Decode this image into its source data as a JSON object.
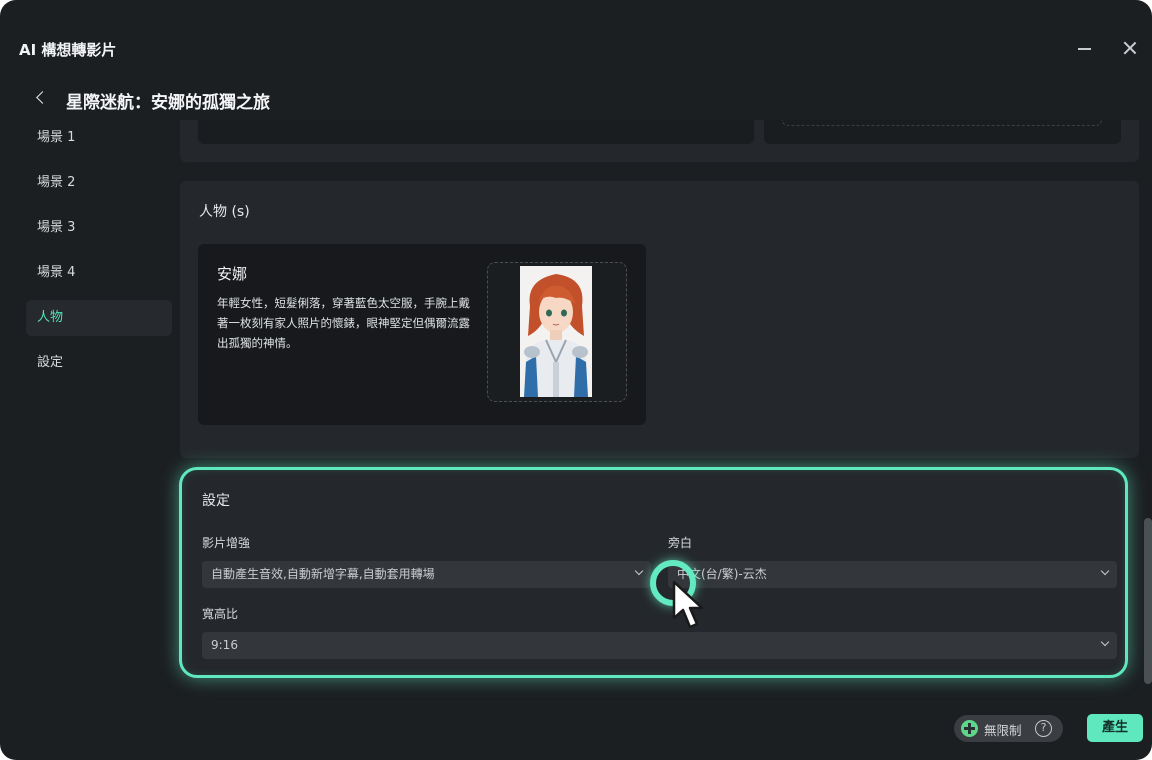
{
  "window": {
    "title": "AI 構想轉影片"
  },
  "header": {
    "project_title": "星際迷航：安娜的孤獨之旅"
  },
  "sidebar": {
    "items": [
      {
        "label": "場景 1"
      },
      {
        "label": "場景 2"
      },
      {
        "label": "場景 3"
      },
      {
        "label": "場景 4"
      },
      {
        "label": "人物"
      },
      {
        "label": "設定"
      }
    ],
    "active_index": 4
  },
  "characters": {
    "heading": "人物 (s)",
    "items": [
      {
        "name": "安娜",
        "description": "年輕女性，短髮俐落，穿著藍色太空服，手腕上戴著一枚刻有家人照片的懷錶，眼神堅定但偶爾流露出孤獨的神情。"
      }
    ]
  },
  "settings": {
    "heading": "設定",
    "video_enhance": {
      "label": "影片增強",
      "value": "自動產生音效,自動新增字幕,自動套用轉場"
    },
    "narration": {
      "label": "旁白",
      "value": "中文(台/繁)-云杰"
    },
    "aspect_ratio": {
      "label": "寬高比",
      "value": "9:16"
    }
  },
  "footer": {
    "plan_label": "無限制",
    "help_symbol": "?",
    "generate_label": "產生"
  },
  "colors": {
    "accent": "#5fe8be",
    "background": "#1c1f22",
    "panel": "#24282c"
  }
}
